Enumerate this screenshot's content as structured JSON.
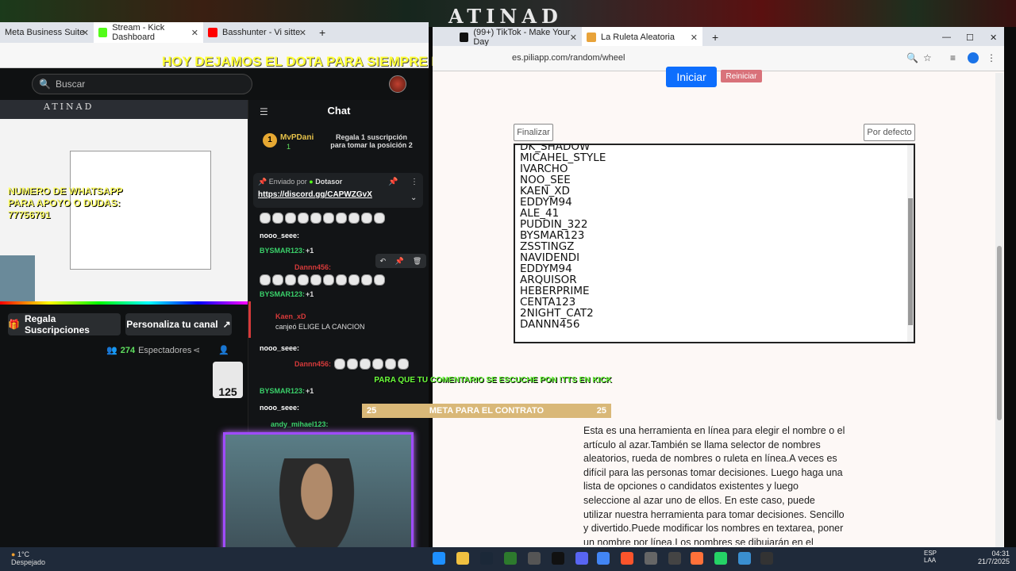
{
  "wallpaper": {
    "brand": "ATINAD"
  },
  "overlay": {
    "banner": "HOY DEJAMOS EL DOTA PARA SIEMPRE NUNCA MAS VUELVO JUGAR ESTE JUEGO DE MRD"
  },
  "left_browser": {
    "tabs": [
      "Meta Business Suite",
      "Stream - Kick Dashboard",
      "Basshunter - Vi sitte"
    ],
    "search_placeholder": "Buscar"
  },
  "preview": {
    "brand": "ATINAD",
    "whatsapp": "NUMERO DE WHATSAPP PARA APOYO O DUDAS: 77756791"
  },
  "stream_actions": {
    "gift": "Regala Suscripciones",
    "customize": "Personaliza tu canal",
    "viewers_count": "274",
    "viewers_label": "Espectadores"
  },
  "chat": {
    "title": "Chat",
    "pinned_user": "MvPDani",
    "pinned_count": "1",
    "pinned_msg": "Regala 1 suscripción para tomar la posición 2",
    "sent_by": "Enviado por",
    "sent_by_user": "Dotasor",
    "link": "https://discord.gg/CAPWZGvX",
    "messages": [
      {
        "user": "nooo_seee:",
        "text": ""
      },
      {
        "user": "BYSMAR123:",
        "text": "+1"
      },
      {
        "user": "Dannn456:",
        "text": ""
      },
      {
        "user": "BYSMAR123:",
        "text": "+1"
      },
      {
        "user": "Kaen_xD",
        "text": "canjeó ELIGE LA CANCION"
      },
      {
        "user": "nooo_seee:",
        "text": ""
      },
      {
        "user": "Dannn456:",
        "text": ""
      },
      {
        "user": "BYSMAR123:",
        "text": "+1"
      },
      {
        "user": "nooo_seee:",
        "text": ""
      },
      {
        "user": "andy_mihael123:",
        "text": ""
      }
    ]
  },
  "right_browser": {
    "tabs": [
      "(99+) TikTok - Make Your Day",
      "La Ruleta Aleatoria"
    ],
    "address": "es.piliapp.com/random/wheel"
  },
  "ruleta": {
    "start": "Iniciar",
    "restart": "Reiniciar",
    "finish": "Finalizar",
    "default": "Por defecto",
    "names": [
      "DK_SHADOW",
      "MICAHEL_STYLE",
      "IVARCHO",
      "NOO_SEE",
      "KAEN_XD",
      "EDDYM94",
      "ALE_41",
      "PUDDIN_322",
      "BYSMAR123",
      "ZSSTINGZ",
      "NAVIDENDI",
      "EDDYM94",
      "ARQUISOR",
      "HEBERPRIME",
      "CENTA123",
      "2NIGHT_CAT2",
      "DANNN456"
    ],
    "description": "Esta es una herramienta en línea para elegir el nombre o el artículo al azar.También se llama selector de nombres aleatorios, rueda de nombres o ruleta en línea.A veces es difícil para las personas tomar decisiones. Luego haga una lista de opciones o candidatos existentes y luego seleccione al azar uno de ellos. En este caso, puede utilizar nuestra herramienta para tomar decisiones. Sencillo y divertido.Puede modificar los nombres en textarea, poner un nombre por línea.Los nombres se dibujarán en el círculo.Simplemente haga clic en la rueda"
  },
  "stream_overlay": {
    "tts_msg": "PARA QUE TU COMENTARIO SE ESCUCHE PON !TTS EN KICK",
    "goal_left": "25",
    "goal_label": "META PARA EL CONTRATO",
    "goal_right": "25"
  },
  "taskbar": {
    "temp": "1°C",
    "weather": "Despejado",
    "lang1": "ESP",
    "lang2": "LAA",
    "time": "04:31",
    "date": "21/7/2025"
  }
}
